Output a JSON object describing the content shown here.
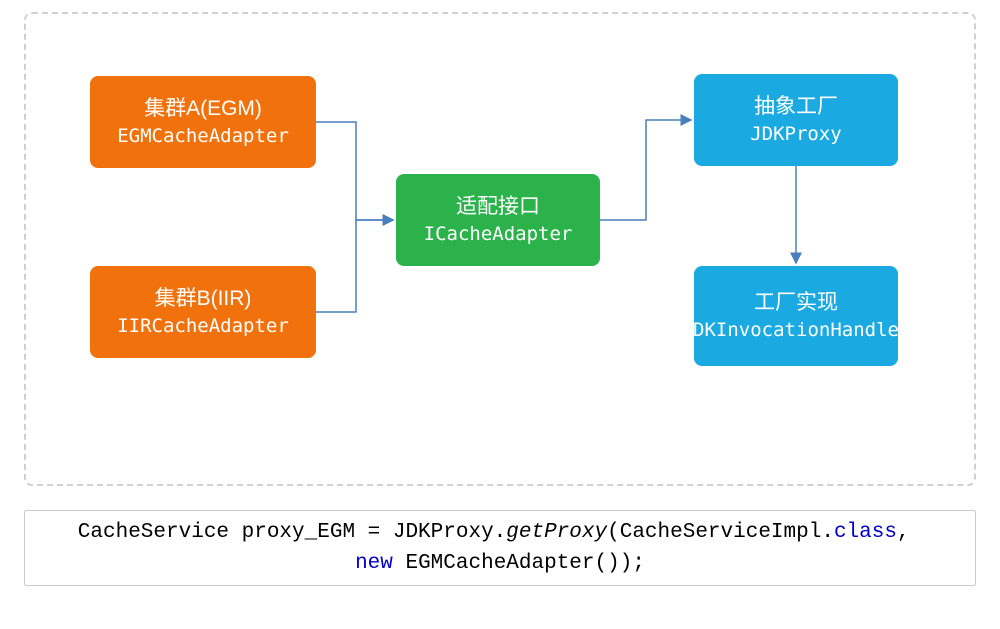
{
  "boxes": {
    "egm": {
      "title": "集群A(EGM)",
      "subtitle": "EGMCacheAdapter"
    },
    "iir": {
      "title": "集群B(IIR)",
      "subtitle": "IIRCacheAdapter"
    },
    "adapter": {
      "title": "适配接口",
      "subtitle": "ICacheAdapter"
    },
    "factory": {
      "title": "抽象工厂",
      "subtitle": "JDKProxy"
    },
    "impl": {
      "title": "工厂实现",
      "subtitle": "JDKInvocationHandler"
    }
  },
  "code": {
    "t1": "CacheService proxy_EGM = JDKProxy.",
    "method": "getProxy",
    "t2": "(CacheServiceImpl.",
    "kw_class": "class",
    "t3": ", ",
    "kw_new": "new",
    "t4": " EGMCacheAdapter());"
  },
  "colors": {
    "orange": "#f1720d",
    "green": "#2bb24b",
    "blue": "#1aa9e0",
    "arrow": "#4a7fbf"
  }
}
